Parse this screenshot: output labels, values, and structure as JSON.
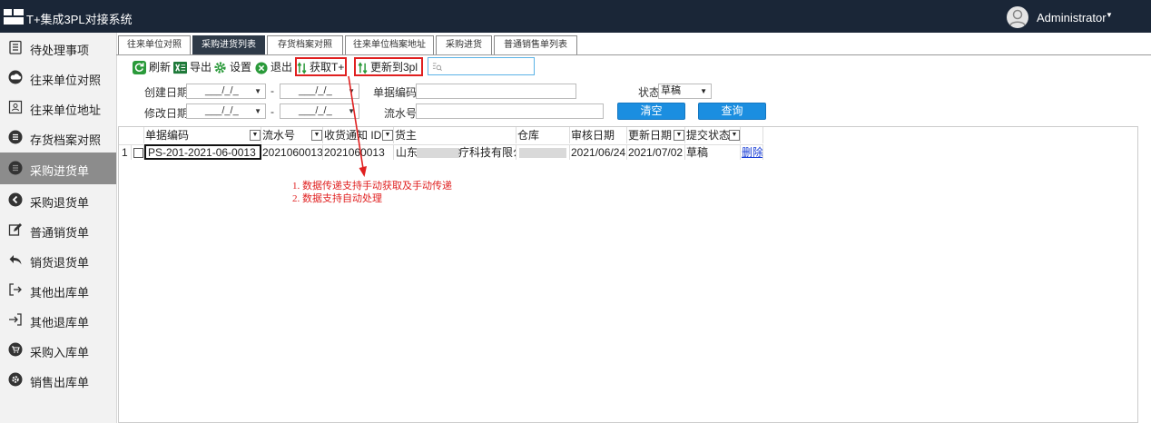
{
  "app": {
    "title": "T+集成3PL对接系统",
    "user": "Administrator"
  },
  "sidebar": {
    "items": [
      {
        "label": "待处理事项",
        "icon": "clipboard-list-icon"
      },
      {
        "label": "往来单位对照",
        "icon": "cloud-icon"
      },
      {
        "label": "往来单位地址",
        "icon": "address-card-icon"
      },
      {
        "label": "存货档案对照",
        "icon": "circle-list-icon"
      },
      {
        "label": "采购进货单",
        "icon": "circle-list-icon"
      },
      {
        "label": "采购退货单",
        "icon": "circle-back-icon"
      },
      {
        "label": "普通销货单",
        "icon": "edit-icon"
      },
      {
        "label": "销货退货单",
        "icon": "reply-icon"
      },
      {
        "label": "其他出库单",
        "icon": "sign-out-icon"
      },
      {
        "label": "其他退库单",
        "icon": "sign-in-icon"
      },
      {
        "label": "采购入库单",
        "icon": "cart-icon"
      },
      {
        "label": "销售出库单",
        "icon": "gear-circle-icon"
      }
    ],
    "active_index": 4
  },
  "tabs": [
    "往来单位对照",
    "采购进货列表",
    "存货档案对照",
    "往来单位档案地址",
    "采购进货",
    "普通销售单列表"
  ],
  "active_tab": 1,
  "toolbar": {
    "refresh": "刷新",
    "export": "导出",
    "settings": "设置",
    "exit": "退出",
    "fetch": "获取T+",
    "update": "更新到3pl",
    "search_placeholder": ""
  },
  "filters": {
    "create_date_label": "创建日期",
    "modify_date_label": "修改日期",
    "date_placeholder": "___/_/_",
    "range_sep": "-",
    "doc_code_label": "单据编码",
    "serial_label": "流水号",
    "status_label": "状态",
    "status_value": "草稿",
    "clear_btn": "清空",
    "query_btn": "查询"
  },
  "table": {
    "headers": [
      "单据编码",
      "流水号",
      "收货通知 ID",
      "货主",
      "仓库",
      "审核日期",
      "更新日期",
      "提交状态"
    ],
    "rows": [
      {
        "num": "1",
        "doc_code": "PS-201-2021-06-0013",
        "serial": "2021060013",
        "receipt_id": "2021060013",
        "owner_prefix": "山东",
        "owner_suffix": "疗科技有限公司",
        "warehouse": "",
        "audit_date": "2021/06/24",
        "update_date": "2021/07/02",
        "status": "草稿",
        "action": "删除"
      }
    ]
  },
  "annotation": {
    "line1": "1. 数据传递支持手动获取及手动传递",
    "line2": "2. 数据支持自动处理",
    "color": "#e02020"
  },
  "colors": {
    "topbar": "#1a2637",
    "active_tab": "#2e3a48",
    "accent_blue": "#1b8ee0",
    "highlight_red": "#e02020",
    "sidebar_active": "#8c8c8c"
  }
}
